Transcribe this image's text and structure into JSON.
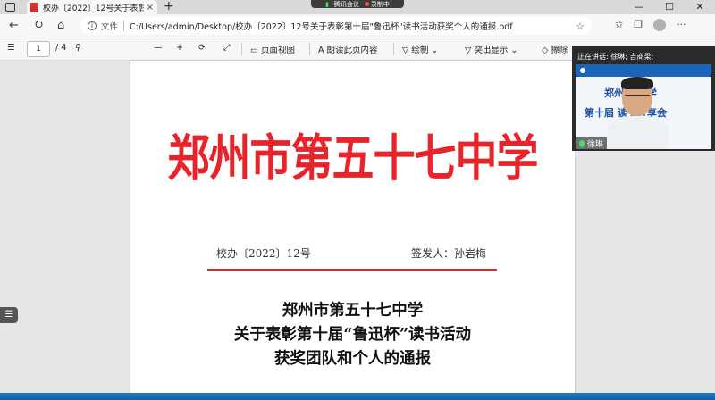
{
  "tab": {
    "title": "校办〔2022〕12号关于表彰第十",
    "close": "×",
    "new_tab": "+"
  },
  "meeting": {
    "app": "腾讯会议",
    "status": "录制中"
  },
  "window_controls": [
    "—",
    "☐",
    "✕"
  ],
  "address": {
    "label": "文件",
    "url": "C:/Users/admin/Desktop/校办〔2022〕12号关于表彰第十届\"鲁迅杯\"读书活动获奖个人的通报.pdf"
  },
  "pdf_toolbar": {
    "page_current": "1",
    "page_total": "/ 4",
    "zoom_out": "—",
    "zoom_in": "+",
    "page_view": "页面视图",
    "read_aloud": "朗读此页内容",
    "draw": "绘制",
    "highlight": "突出显示",
    "erase": "擦除"
  },
  "document": {
    "masthead": "郑州市第五十七中学",
    "doc_number": "校办〔2022〕12号",
    "signer": "签发人：孙岩梅",
    "notice_line1": "郑州市第五十七中学",
    "notice_line2": "关于表彰第十届“鲁迅杯”读书活动",
    "notice_line3": "获奖团队和个人的通报"
  },
  "video": {
    "speaking": "正在讲话: 徐琳; 吉商梁;",
    "banner_line1": "郑州  七中学",
    "banner_line2": "第十届      读书分享会",
    "participant": "徐琳"
  },
  "colors": {
    "accent": "#e8232a",
    "banner": "#1b64b8"
  }
}
